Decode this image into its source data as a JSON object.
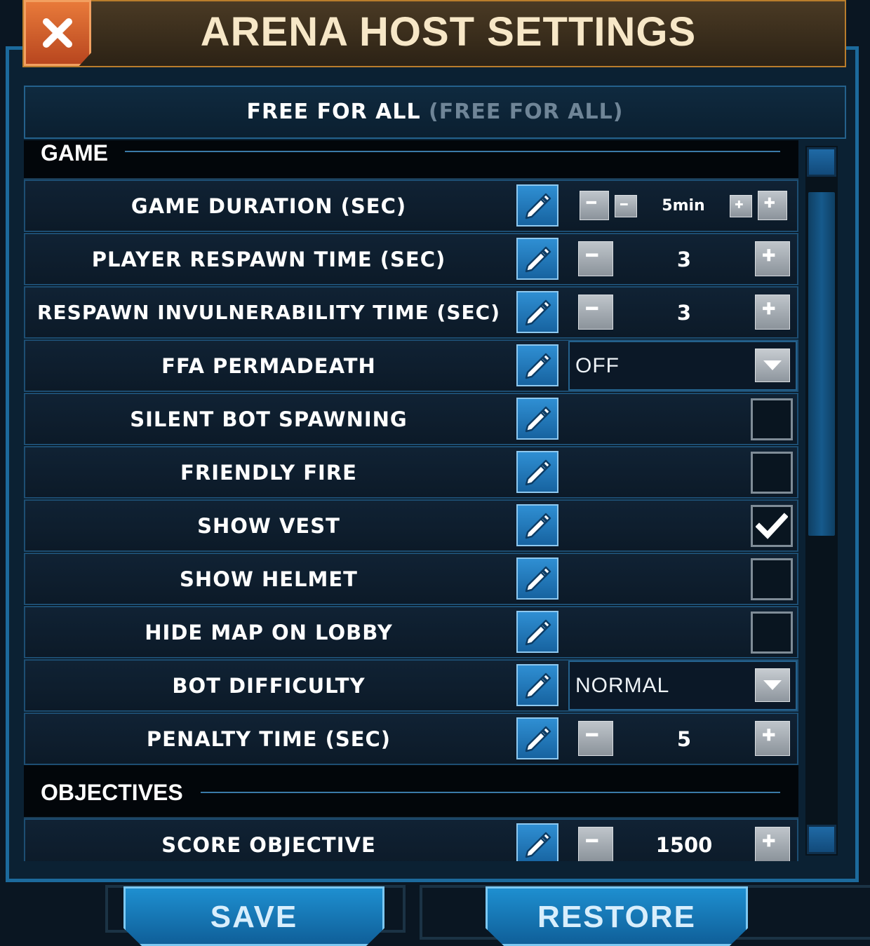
{
  "window": {
    "title": "ARENA HOST SETTINGS",
    "mode": "FREE FOR ALL",
    "mode_sub": "(FREE FOR ALL)"
  },
  "sections": {
    "game": "GAME",
    "objectives": "OBJECTIVES"
  },
  "rows": [
    {
      "label": "GAME DURATION (SEC)",
      "type": "stepper",
      "value": "5min"
    },
    {
      "label": "PLAYER RESPAWN TIME (SEC)",
      "type": "stepper",
      "value": "3"
    },
    {
      "label": "RESPAWN INVULNERABILITY TIME (SEC)",
      "type": "stepper",
      "value": "3"
    },
    {
      "label": "FFA PERMADEATH",
      "type": "dropdown",
      "value": "OFF"
    },
    {
      "label": "SILENT BOT SPAWNING",
      "type": "checkbox",
      "checked": false
    },
    {
      "label": "FRIENDLY FIRE",
      "type": "checkbox",
      "checked": false
    },
    {
      "label": "SHOW VEST",
      "type": "checkbox",
      "checked": true
    },
    {
      "label": "SHOW HELMET",
      "type": "checkbox",
      "checked": false
    },
    {
      "label": "HIDE MAP ON LOBBY",
      "type": "checkbox",
      "checked": false
    },
    {
      "label": "BOT DIFFICULTY",
      "type": "dropdown",
      "value": "NORMAL"
    },
    {
      "label": "PENALTY TIME (SEC)",
      "type": "stepper",
      "value": "5"
    },
    {
      "label": "SCORE OBJECTIVE",
      "type": "stepper",
      "value": "1500"
    }
  ],
  "buttons": {
    "save": "SAVE",
    "restore": "RESTORE"
  },
  "icons": {
    "close": "close-icon",
    "edit": "pencil-icon",
    "minus": "minus-icon",
    "plus": "plus-icon",
    "dropdown": "chevron-down-icon",
    "check": "checkmark-icon"
  },
  "colors": {
    "header_accent": "#b97d2c",
    "panel_border": "#1c6a9c",
    "button_blue": "#1e8fd0"
  }
}
